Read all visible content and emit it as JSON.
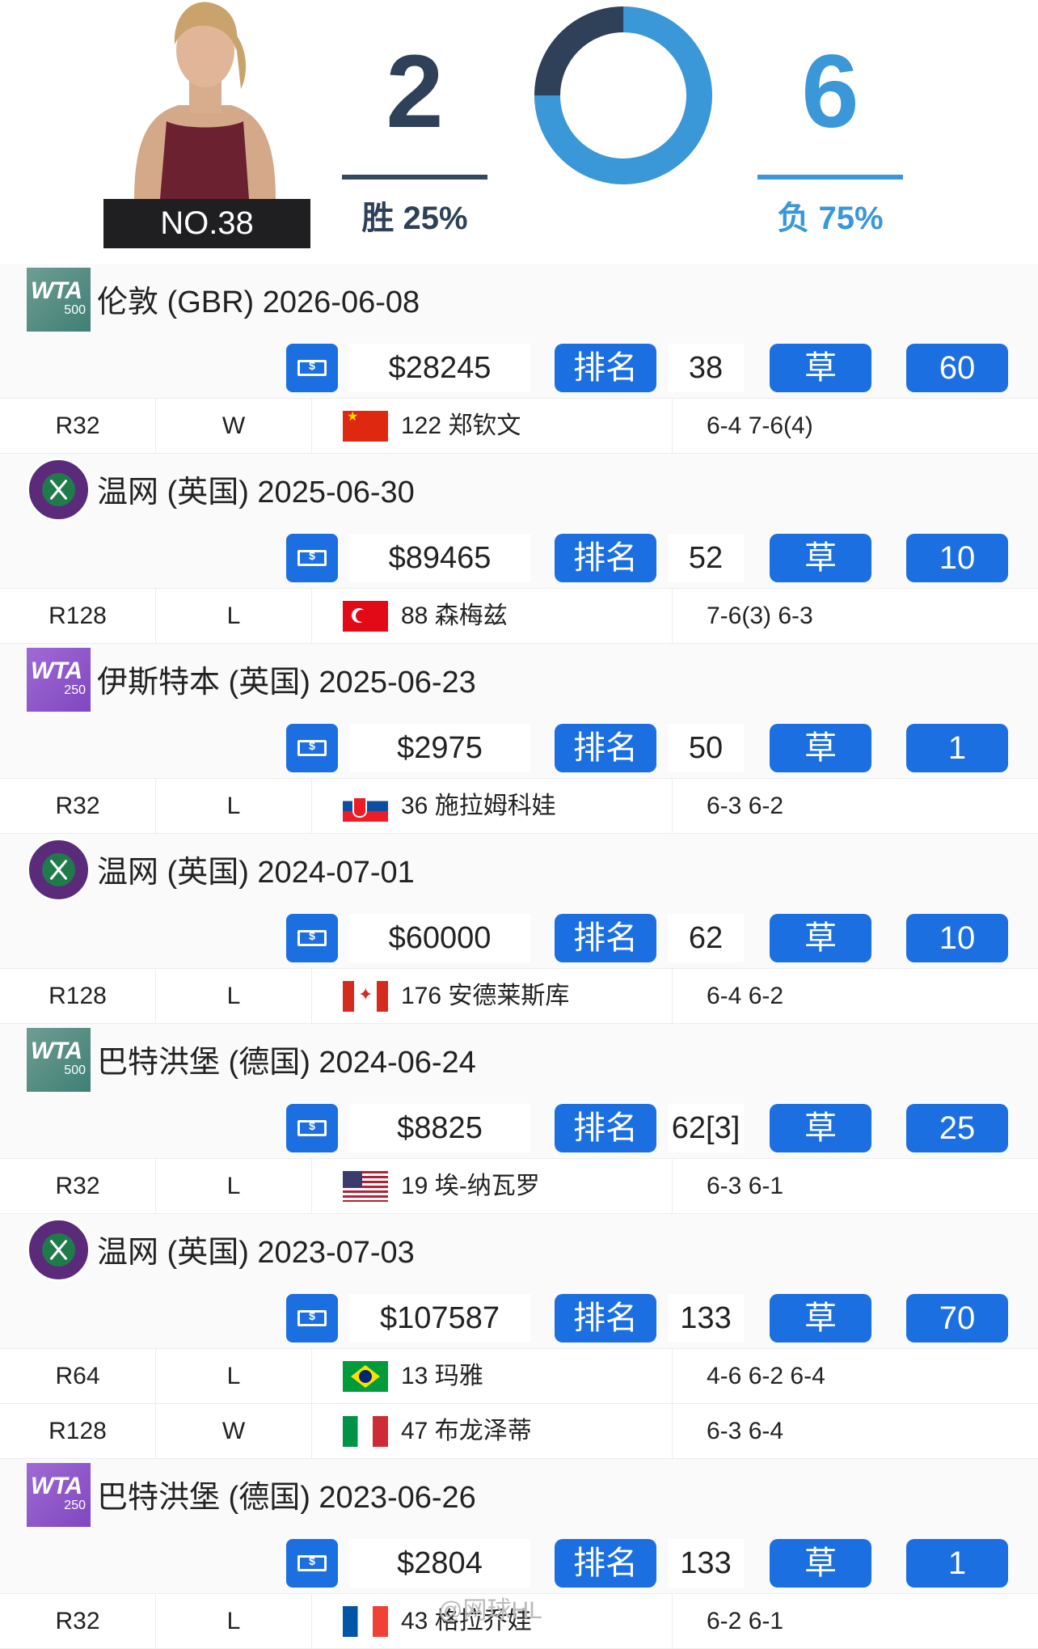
{
  "player": {
    "rank_tag": "NO.38",
    "wins": "2",
    "losses": "6",
    "win_pct": "胜 25%",
    "loss_pct": "负 75%",
    "win_fraction": 0.25,
    "colors": {
      "win": "#2e4159",
      "loss": "#3a97d8"
    }
  },
  "labels": {
    "rank": "排名",
    "money_icon": "money-icon"
  },
  "tournaments": [
    {
      "logo": "wta500",
      "logo_text": "WTA",
      "logo_level": "500",
      "title": "伦敦 (GBR) 2026-06-08",
      "prize": "$28245",
      "rank": "38",
      "surface": "草",
      "points": "60",
      "matches": [
        {
          "round": "R32",
          "result": "W",
          "flag": "cn",
          "opponent": "122 郑钦文",
          "score": "6-4 7-6(4)"
        }
      ]
    },
    {
      "logo": "wimb",
      "logo_text": "",
      "logo_level": "",
      "title": "温网 (英国) 2025-06-30",
      "prize": "$89465",
      "rank": "52",
      "surface": "草",
      "points": "10",
      "matches": [
        {
          "round": "R128",
          "result": "L",
          "flag": "tr",
          "opponent": "88 森梅兹",
          "score": "7-6(3) 6-3"
        }
      ]
    },
    {
      "logo": "wta250",
      "logo_text": "WTA",
      "logo_level": "250",
      "title": "伊斯特本 (英国) 2025-06-23",
      "prize": "$2975",
      "rank": "50",
      "surface": "草",
      "points": "1",
      "matches": [
        {
          "round": "R32",
          "result": "L",
          "flag": "sk",
          "opponent": "36 施拉姆科娃",
          "score": "6-3 6-2"
        }
      ]
    },
    {
      "logo": "wimb",
      "logo_text": "",
      "logo_level": "",
      "title": "温网 (英国) 2024-07-01",
      "prize": "$60000",
      "rank": "62",
      "surface": "草",
      "points": "10",
      "matches": [
        {
          "round": "R128",
          "result": "L",
          "flag": "ca",
          "opponent": "176 安德莱斯库",
          "score": "6-4 6-2"
        }
      ]
    },
    {
      "logo": "wta500",
      "logo_text": "WTA",
      "logo_level": "500",
      "title": "巴特洪堡 (德国) 2024-06-24",
      "prize": "$8825",
      "rank": "62[3]",
      "surface": "草",
      "points": "25",
      "matches": [
        {
          "round": "R32",
          "result": "L",
          "flag": "us",
          "opponent": "19 埃-纳瓦罗",
          "score": "6-3 6-1"
        }
      ]
    },
    {
      "logo": "wimb",
      "logo_text": "",
      "logo_level": "",
      "title": "温网 (英国) 2023-07-03",
      "prize": "$107587",
      "rank": "133",
      "surface": "草",
      "points": "70",
      "matches": [
        {
          "round": "R64",
          "result": "L",
          "flag": "br",
          "opponent": "13 玛雅",
          "score": "4-6 6-2 6-4"
        },
        {
          "round": "R128",
          "result": "W",
          "flag": "it",
          "opponent": "47 布龙泽蒂",
          "score": "6-3 6-4"
        }
      ]
    },
    {
      "logo": "wta250",
      "logo_text": "WTA",
      "logo_level": "250",
      "title": "巴特洪堡 (德国) 2023-06-26",
      "prize": "$2804",
      "rank": "133",
      "surface": "草",
      "points": "1",
      "matches": [
        {
          "round": "R32",
          "result": "L",
          "flag": "fr",
          "opponent": "43 格拉乔娃",
          "score": "6-2 6-1"
        }
      ]
    }
  ],
  "watermark": "@网球HL"
}
